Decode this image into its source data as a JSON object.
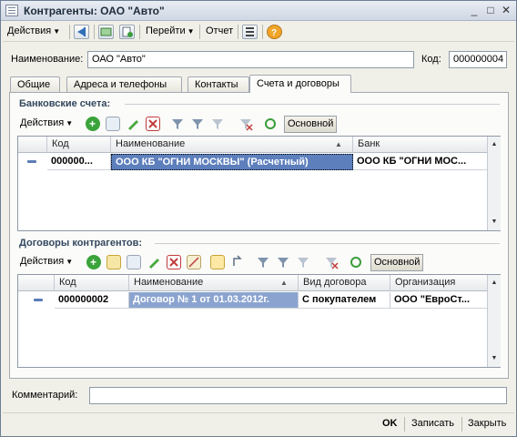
{
  "window": {
    "title": "Контрагенты: ОАО \"Авто\""
  },
  "toolbar": {
    "actions_label": "Действия",
    "goto_label": "Перейти",
    "report_label": "Отчет"
  },
  "header": {
    "name_label": "Наименование:",
    "name_value": "ОАО \"Авто\"",
    "code_label": "Код:",
    "code_value": "000000004"
  },
  "tabs": [
    {
      "label": "Общие"
    },
    {
      "label": "Адреса и телефоны"
    },
    {
      "label": "Контакты"
    },
    {
      "label": "Счета и договоры"
    }
  ],
  "bank_section": {
    "title": "Банковские счета:",
    "actions_label": "Действия",
    "main_label": "Основной",
    "columns": [
      "Код",
      "Наименование",
      "Банк"
    ],
    "rows": [
      {
        "code": "000000...",
        "name": "ООО КБ \"ОГНИ МОСКВЫ\" (Расчетный)",
        "bank": "ООО КБ \"ОГНИ МОС..."
      }
    ]
  },
  "contracts_section": {
    "title": "Договоры контрагентов:",
    "actions_label": "Действия",
    "main_label": "Основной",
    "columns": [
      "Код",
      "Наименование",
      "Вид договора",
      "Организация"
    ],
    "rows": [
      {
        "code": "000000002",
        "name": "Договор № 1 от 01.03.2012г.",
        "kind": "С покупателем",
        "org": "ООО \"ЕвроСт..."
      }
    ]
  },
  "comment": {
    "label": "Комментарий:",
    "value": ""
  },
  "footer": {
    "ok_label": "OK",
    "save_label": "Записать",
    "close_label": "Закрыть"
  }
}
